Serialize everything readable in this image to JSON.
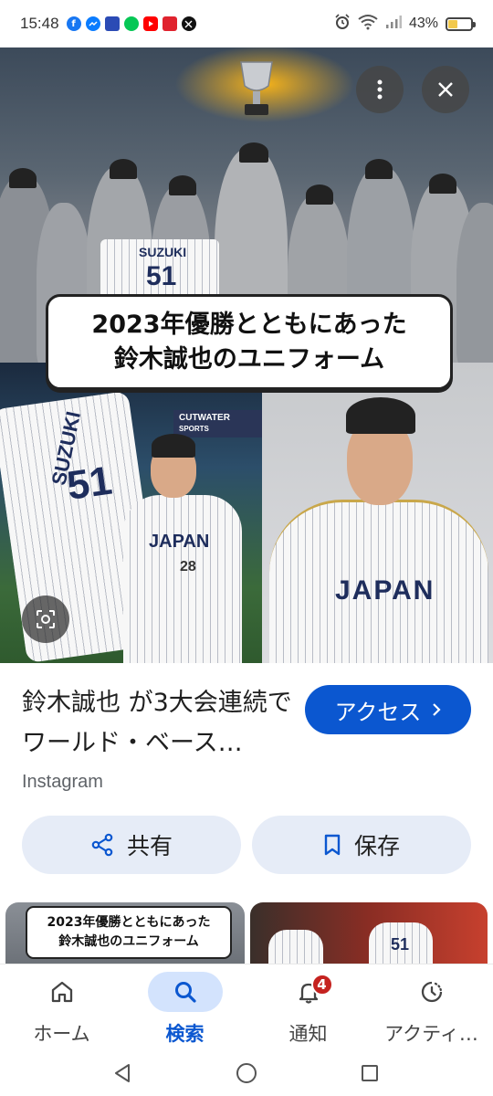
{
  "status_bar": {
    "time": "15:48",
    "battery_percent": "43%",
    "battery_level": 0.43,
    "notification_apps": [
      "facebook-icon",
      "messenger-icon",
      "news-icon",
      "line-icon",
      "youtube-icon",
      "app-icon",
      "x-icon"
    ],
    "system_icons": [
      "alarm-icon",
      "wifi-icon",
      "signal-icon",
      "battery-icon"
    ]
  },
  "image_viewer": {
    "image_caption_line1": "2023年優勝とともにあった",
    "image_caption_line2": "鈴木誠也のユニフォーム",
    "held_jersey_name": "SUZUKI",
    "held_jersey_number": "51",
    "front_jersey_text": "JAPAN",
    "player_number": "28",
    "ad_text": "CUTWATER",
    "ad_sub": "SPORTS",
    "more_button_icon": "more-vert-icon",
    "close_button_icon": "close-icon",
    "lens_button_icon": "lens-icon"
  },
  "result": {
    "title": "鈴木誠也 が3大会連続でワールド・ベース…",
    "source": "Instagram",
    "access_label": "アクセス",
    "share_label": "共有",
    "save_label": "保存"
  },
  "related": {
    "thumb1_line1": "2023年優勝とともにあった",
    "thumb1_line2": "鈴木誠也のユニフォーム",
    "thumb2_jersey_number": "51"
  },
  "bottom_nav": {
    "items": [
      {
        "label": "ホーム",
        "icon": "home-icon"
      },
      {
        "label": "検索",
        "icon": "search-icon"
      },
      {
        "label": "通知",
        "icon": "bell-icon",
        "badge": "4"
      },
      {
        "label": "アクティ…",
        "icon": "activity-icon"
      }
    ]
  },
  "colors": {
    "accent": "#0b57d0",
    "pill_bg": "#e6ecf7",
    "nav_active_bg": "#d3e3fd",
    "badge": "#c5221f"
  }
}
